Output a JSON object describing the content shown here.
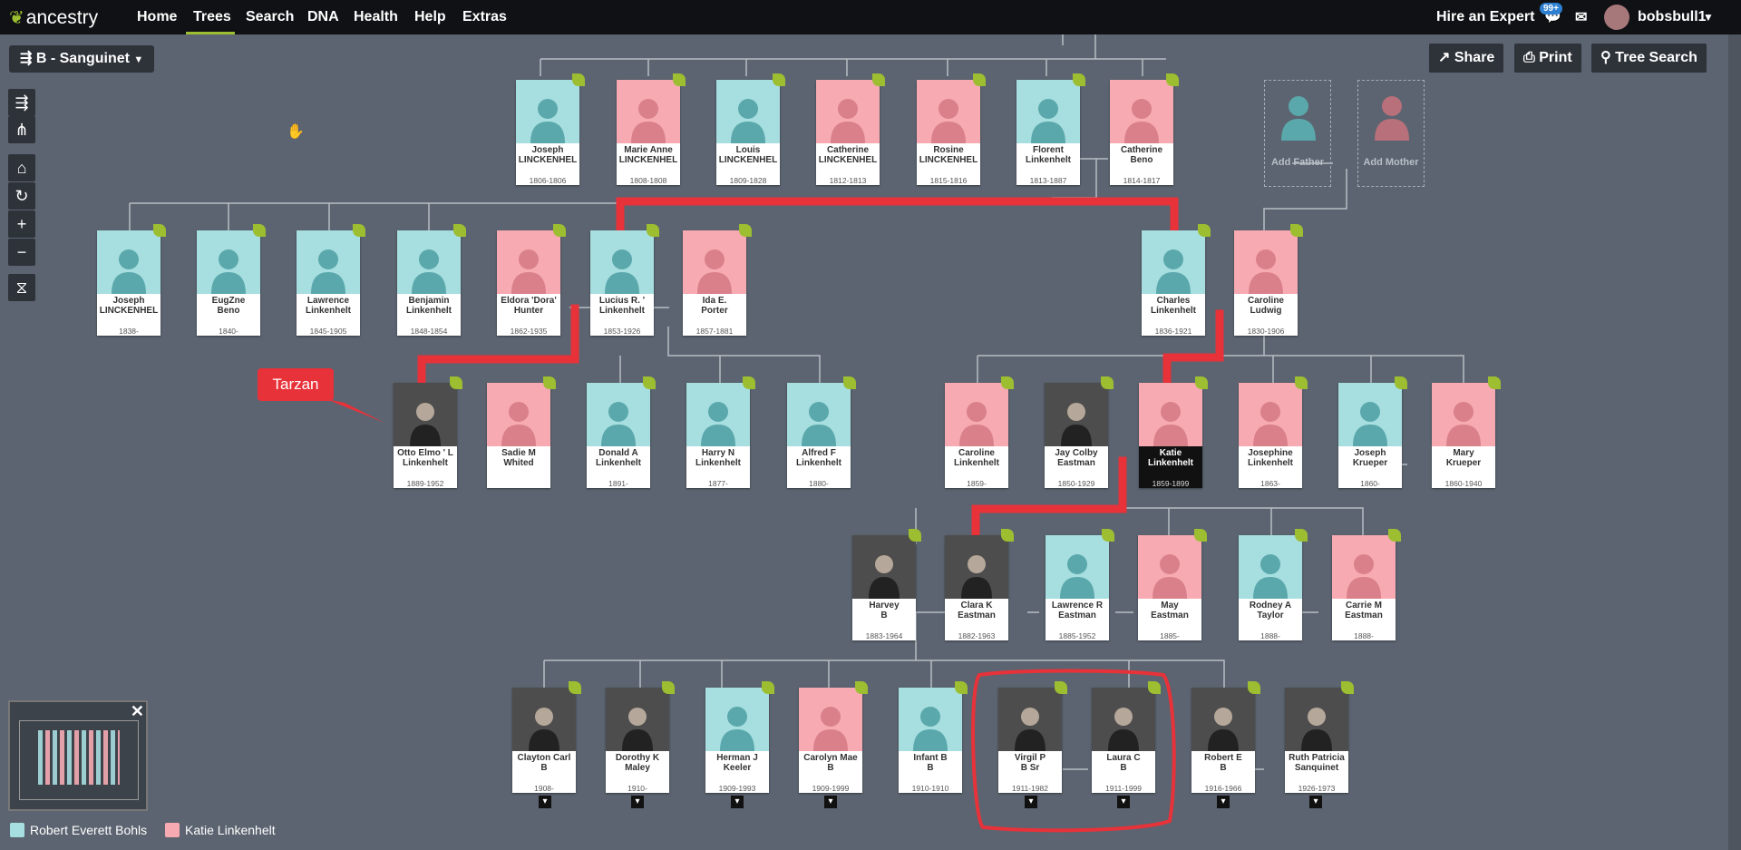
{
  "nav": {
    "logo": "ancestry",
    "items": [
      "Home",
      "Trees",
      "Search",
      "DNA",
      "Health",
      "Help",
      "Extras"
    ],
    "hire": "Hire an Expert",
    "badge": "99+",
    "user": "bobsbull1"
  },
  "tree_title": "B      - Sanguinet",
  "toolbar": {
    "share": "Share",
    "print": "Print",
    "tree_search": "Tree Search"
  },
  "tarzan": "Tarzan",
  "add": {
    "father": "Add Father",
    "mother": "Add Mother"
  },
  "legend": {
    "left": "Robert Everett Bohls",
    "right": "Katie Linkenhelt"
  },
  "colors": {
    "male": "#a7dee0",
    "female": "#f7aab2",
    "accent": "#9cbe30",
    "highlight": "#e8323a"
  },
  "people": [
    {
      "n1": "Joseph",
      "n2": "LINCKENHEL",
      "d": "1806-1806",
      "g": "m"
    },
    {
      "n1": "Marie Anne",
      "n2": "LINCKENHEL",
      "d": "1808-1808",
      "g": "f"
    },
    {
      "n1": "Louis",
      "n2": "LINCKENHEL",
      "d": "1809-1828",
      "g": "m"
    },
    {
      "n1": "Catherine",
      "n2": "LINCKENHEL",
      "d": "1812-1813",
      "g": "f"
    },
    {
      "n1": "Rosine",
      "n2": "LINCKENHEL",
      "d": "1815-1816",
      "g": "f"
    },
    {
      "n1": "Florent",
      "n2": "Linkenhelt",
      "d": "1813-1887",
      "g": "m"
    },
    {
      "n1": "Catherine",
      "n2": "Beno",
      "d": "1814-1817",
      "g": "f"
    },
    {
      "n1": "Joseph",
      "n2": "LINCKENHEL",
      "d": "1838-",
      "g": "m"
    },
    {
      "n1": "EugZne",
      "n2": "Beno",
      "d": "1840-",
      "g": "m"
    },
    {
      "n1": "Lawrence",
      "n2": "Linkenhelt",
      "d": "1845-1905",
      "g": "m"
    },
    {
      "n1": "Benjamin",
      "n2": "Linkenhelt",
      "d": "1848-1854",
      "g": "m"
    },
    {
      "n1": "Eldora 'Dora'",
      "n2": "Hunter",
      "d": "1862-1935",
      "g": "f"
    },
    {
      "n1": "Lucius R. '",
      "n2": "Linkenhelt",
      "d": "1853-1926",
      "g": "m"
    },
    {
      "n1": "Ida E.",
      "n2": "Porter",
      "d": "1857-1881",
      "g": "f"
    },
    {
      "n1": "Charles",
      "n2": "Linkenhelt",
      "d": "1836-1921",
      "g": "m"
    },
    {
      "n1": "Caroline",
      "n2": "Ludwig",
      "d": "1830-1906",
      "g": "f"
    },
    {
      "n1": "Otto Elmo ' L",
      "n2": "Linkenhelt",
      "d": "1889-1952",
      "g": "p"
    },
    {
      "n1": "Sadie M",
      "n2": "Whited",
      "d": "",
      "g": "f"
    },
    {
      "n1": "Donald A",
      "n2": "Linkenhelt",
      "d": "1891-",
      "g": "m"
    },
    {
      "n1": "Harry N",
      "n2": "Linkenhelt",
      "d": "1877-",
      "g": "m"
    },
    {
      "n1": "Alfred F",
      "n2": "Linkenhelt",
      "d": "1880-",
      "g": "m"
    },
    {
      "n1": "Caroline",
      "n2": "Linkenhelt",
      "d": "1859-",
      "g": "f"
    },
    {
      "n1": "Jay Colby",
      "n2": "Eastman",
      "d": "1850-1929",
      "g": "p"
    },
    {
      "n1": "Katie",
      "n2": "Linkenhelt",
      "d": "1859-1899",
      "g": "f",
      "sel": true
    },
    {
      "n1": "Josephine",
      "n2": "Linkenhelt",
      "d": "1863-",
      "g": "f"
    },
    {
      "n1": "Joseph",
      "n2": "Krueper",
      "d": "1860-",
      "g": "m"
    },
    {
      "n1": "Mary",
      "n2": "Krueper",
      "d": "1860-1940",
      "g": "f"
    },
    {
      "n1": "Harvey",
      "n2": "B",
      "d": "1883-1964",
      "g": "p"
    },
    {
      "n1": "Clara K",
      "n2": "Eastman",
      "d": "1882-1963",
      "g": "p"
    },
    {
      "n1": "Lawrence R",
      "n2": "Eastman",
      "d": "1885-1952",
      "g": "m"
    },
    {
      "n1": "May",
      "n2": "Eastman",
      "d": "1885-",
      "g": "f"
    },
    {
      "n1": "Rodney A",
      "n2": "Taylor",
      "d": "1888-",
      "g": "m"
    },
    {
      "n1": "Carrie M",
      "n2": "Eastman",
      "d": "1888-",
      "g": "f"
    },
    {
      "n1": "Clayton Carl",
      "n2": "B",
      "d": "1908-",
      "g": "p"
    },
    {
      "n1": "Dorothy K",
      "n2": "Maley",
      "d": "1910-",
      "g": "p"
    },
    {
      "n1": "Herman J",
      "n2": "Keeler",
      "d": "1909-1993",
      "g": "m"
    },
    {
      "n1": "Carolyn Mae",
      "n2": "B",
      "d": "1909-1999",
      "g": "f"
    },
    {
      "n1": "Infant B",
      "n2": "B",
      "d": "1910-1910",
      "g": "m"
    },
    {
      "n1": "Virgil P",
      "n2": "B      Sr",
      "d": "1911-1982",
      "g": "p"
    },
    {
      "n1": "Laura C",
      "n2": "B",
      "d": "1911-1999",
      "g": "p"
    },
    {
      "n1": "Robert E",
      "n2": "B",
      "d": "1916-1966",
      "g": "p"
    },
    {
      "n1": "Ruth Patricia",
      "n2": "Sanquinet",
      "d": "1926-1973",
      "g": "p"
    }
  ]
}
